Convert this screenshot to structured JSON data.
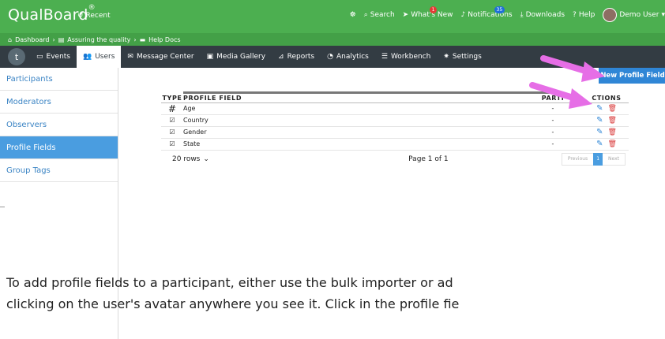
{
  "topbar": {
    "brand": "QualBoard",
    "brand_mark": "®",
    "recent": "Recent",
    "search": "Search",
    "whats_new": "What's New",
    "whats_new_badge": "1",
    "notifications": "Notifications",
    "notifications_badge": "35",
    "downloads": "Downloads",
    "help": "Help",
    "user": "Demo User",
    "bg_color": "#4caf50"
  },
  "breadcrumb": {
    "items": [
      "Dashboard",
      "Assuring the quality",
      "Help Docs"
    ]
  },
  "nav": {
    "t_label": "t",
    "items": [
      "Events",
      "Users",
      "Message Center",
      "Media Gallery",
      "Reports",
      "Analytics",
      "Workbench",
      "Settings"
    ],
    "active": "Users"
  },
  "sidebar": {
    "items": [
      "Participants",
      "Moderators",
      "Observers",
      "Profile Fields",
      "Group Tags"
    ],
    "active": "Profile Fields"
  },
  "new_button": "New Profile Field",
  "table": {
    "headers": {
      "type": "TYPE",
      "field": "PROFILE FIELD",
      "participants": "PARTI",
      "actions": "CTIONS"
    },
    "rows": [
      {
        "type_icon": "hash-icon",
        "field": "Age",
        "participants": "-"
      },
      {
        "type_icon": "choice-icon",
        "field": "Country",
        "participants": "-"
      },
      {
        "type_icon": "choice-icon",
        "field": "Gender",
        "participants": "-"
      },
      {
        "type_icon": "choice-icon",
        "field": "State",
        "participants": "-"
      }
    ],
    "rows_select": "20 rows",
    "page_info": "Page 1 of 1",
    "pager": {
      "previous": "Previous",
      "current": "1",
      "next": "Next"
    }
  },
  "help_text": {
    "line1": "To add profile fields to a participant, either use the bulk importer or ad",
    "line2": "clicking on the user's avatar anywhere you see it. Click in the profile fie"
  },
  "colors": {
    "accent": "#2f86d6",
    "annotation_arrow": "#e66ee6",
    "danger": "#d93a3a"
  }
}
